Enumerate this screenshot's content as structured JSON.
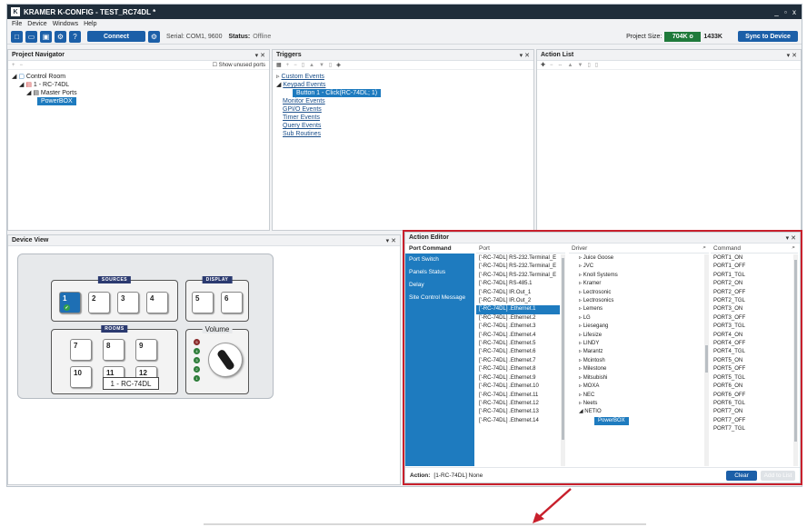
{
  "window": {
    "title": "KRAMER K-CONFIG - TEST_RC74DL *",
    "controls": "_ ▫ x",
    "logo": "K"
  },
  "menu": [
    "File",
    "Device",
    "Windows",
    "Help"
  ],
  "toolbar": {
    "connect_label": "Connect",
    "serial": "Serial: COM1, 9600",
    "status_label": "Status:",
    "status_value": "Offline",
    "project_size_label": "Project Size:",
    "project_size_used": "704K o",
    "project_size_total": "1433K",
    "sync_label": "Sync to Device"
  },
  "project_navigator": {
    "title": "Project Navigator",
    "show_unused": "Show unused ports",
    "tree": [
      "Control Room",
      "1 - RC-74DL",
      "Master Ports",
      "PowerBOX"
    ]
  },
  "triggers": {
    "title": "Triggers",
    "items": [
      "Custom Events",
      "Keypad Events",
      "Button 1 - Click(RC-74DL; 1)",
      "Monitor Events",
      "GPI/O Events",
      "Timer Events",
      "Query Events",
      "Sub Routines"
    ]
  },
  "action_list": {
    "title": "Action List"
  },
  "device_view": {
    "title": "Device View",
    "groups": {
      "sources": "SOURCES",
      "display": "DISPLAY",
      "rooms": "ROOMS",
      "volume": "Volume"
    },
    "keys": [
      "1",
      "2",
      "3",
      "4",
      "5",
      "6",
      "7",
      "8",
      "9",
      "10",
      "11",
      "12"
    ],
    "leds": [
      "5",
      "4",
      "3",
      "2",
      "1"
    ],
    "device_name": "1 - RC-74DL"
  },
  "action_editor": {
    "title": "Action Editor",
    "categories": [
      "Port Command",
      "Port Switch",
      "Panels Status",
      "Delay",
      "Site Control Message"
    ],
    "port_header": "Port",
    "ports": [
      "['-RC-74DL] RS-232.Terminal_E",
      "['-RC-74DL] RS-232.Terminal_E",
      "['-RC-74DL] RS-232.Terminal_E",
      "['-RC-74DL] RS-485.1",
      "['-RC-74DL] IR.Out_1",
      "['-RC-74DL] IR.Out_2",
      "['-RC-74DL] .Ethernet.1",
      "['-RC-74DL] .Ethernet.2",
      "['-RC-74DL] .Ethernet.3",
      "['-RC-74DL] .Ethernet.4",
      "['-RC-74DL] .Ethernet.5",
      "['-RC-74DL] .Ethernet.6",
      "['-RC-74DL] .Ethernet.7",
      "['-RC-74DL] .Ethernet.8",
      "['-RC-74DL] .Ethernet.9",
      "['-RC-74DL] .Ethernet.10",
      "['-RC-74DL] .Ethernet.11",
      "['-RC-74DL] .Ethernet.12",
      "['-RC-74DL] .Ethernet.13",
      "['-RC-74DL] .Ethernet.14"
    ],
    "driver_header": "Driver",
    "drivers": [
      "Juice Goose",
      "JVC",
      "Knoll Systems",
      "Kramer",
      "Lectrosonic",
      "Lectrosonics",
      "Lemens",
      "LG",
      "Liesegang",
      "Lifesize",
      "LINDY",
      "Marantz",
      "Mcintosh",
      "Milestone",
      "Mitsubishi",
      "MOXA",
      "NEC",
      "Neets",
      "NETIO",
      "PowerBOX"
    ],
    "command_header": "Command",
    "commands": [
      "PORT1_ON",
      "PORT1_OFF",
      "PORT1_TGL",
      "PORT2_ON",
      "PORT2_OFF",
      "PORT2_TGL",
      "PORT3_ON",
      "PORT3_OFF",
      "PORT3_TGL",
      "PORT4_ON",
      "PORT4_OFF",
      "PORT4_TGL",
      "PORT5_ON",
      "PORT5_OFF",
      "PORT5_TGL",
      "PORT6_ON",
      "PORT6_OFF",
      "PORT6_TGL",
      "PORT7_ON",
      "PORT7_OFF",
      "PORT7_TGL"
    ],
    "action_label": "Action:",
    "action_value": "[1-RC-74DL] None",
    "clear_label": "Clear",
    "add_label": "Add to List"
  }
}
